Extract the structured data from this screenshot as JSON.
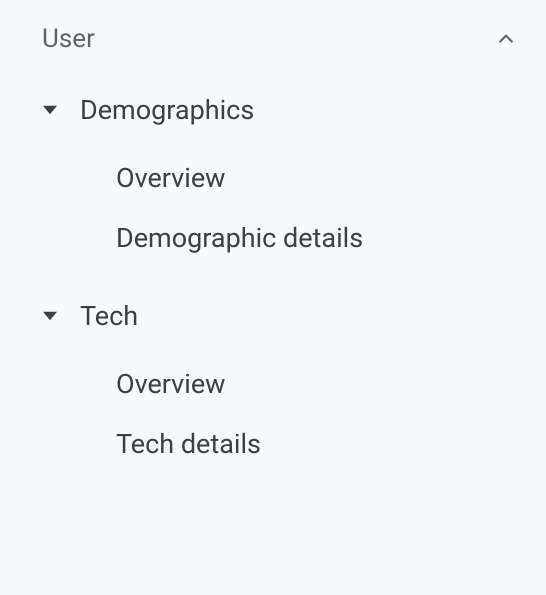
{
  "section": {
    "label": "User",
    "expanded": true,
    "subsections": [
      {
        "label": "Demographics",
        "expanded": true,
        "items": [
          {
            "label": "Overview"
          },
          {
            "label": "Demographic details"
          }
        ]
      },
      {
        "label": "Tech",
        "expanded": true,
        "items": [
          {
            "label": "Overview"
          },
          {
            "label": "Tech details"
          }
        ]
      }
    ]
  }
}
